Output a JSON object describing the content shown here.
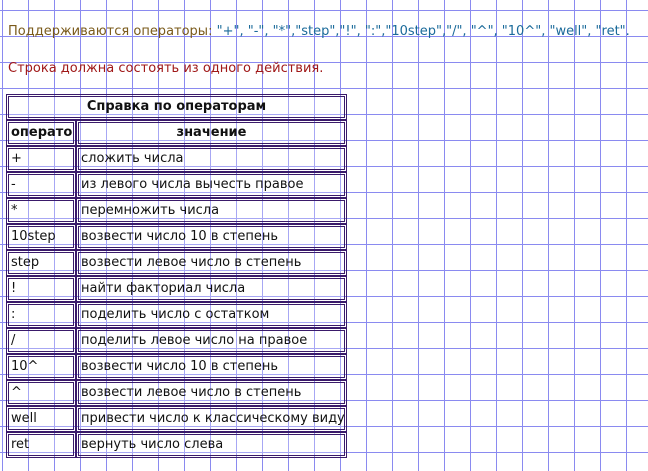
{
  "intro": {
    "prefix": "Поддерживаются операторы: ",
    "operators": "\"+\", \"-\", \"*\",\"step\",\"!\", \":\",\"10step\",\"/\", \"^\", \"10^\", \"well\", \"ret\".",
    "rule": "Строка должна состоять из одного действия."
  },
  "table": {
    "title": "Справка по операторам",
    "col_operator": "оператор",
    "col_meaning": "значение",
    "rows": [
      {
        "op": "+",
        "meaning": "сложить числа"
      },
      {
        "op": "-",
        "meaning": "из левого числа вычесть правое"
      },
      {
        "op": "*",
        "meaning": "перемножить числа"
      },
      {
        "op": "10step",
        "meaning": "возвести число 10 в степень"
      },
      {
        "op": "step",
        "meaning": "возвести левое число в степень"
      },
      {
        "op": "!",
        "meaning": "найти факториал числа"
      },
      {
        "op": ":",
        "meaning": "поделить число с остатком"
      },
      {
        "op": "/",
        "meaning": "поделить левое число на правое"
      },
      {
        "op": "10^",
        "meaning": "возвести число 10 в степень"
      },
      {
        "op": "^",
        "meaning": "возвести левое число в степень"
      },
      {
        "op": "well",
        "meaning": "привести число к классическому виду"
      },
      {
        "op": "ret",
        "meaning": "вернуть число слева"
      }
    ]
  },
  "colors": {
    "grid": "#8a8af0",
    "intro_text": "#7a5a1a",
    "operators_text": "#1a6a9a",
    "rule_text": "#a01818",
    "cell_border": "#3a1a6a"
  }
}
